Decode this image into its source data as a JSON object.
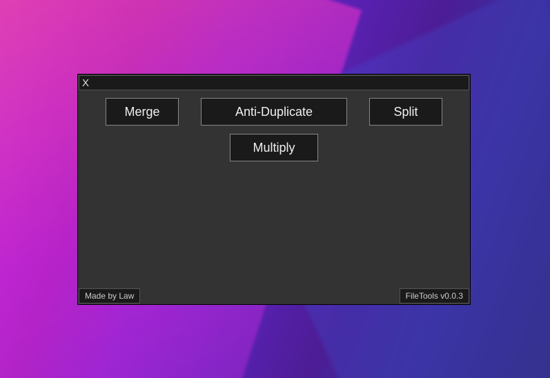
{
  "titlebar": {
    "close_label": "X"
  },
  "buttons": {
    "merge": "Merge",
    "anti_duplicate": "Anti-Duplicate",
    "split": "Split",
    "multiply": "Multiply"
  },
  "footer": {
    "author": "Made by Law",
    "version": "FileTools v0.0.3"
  }
}
